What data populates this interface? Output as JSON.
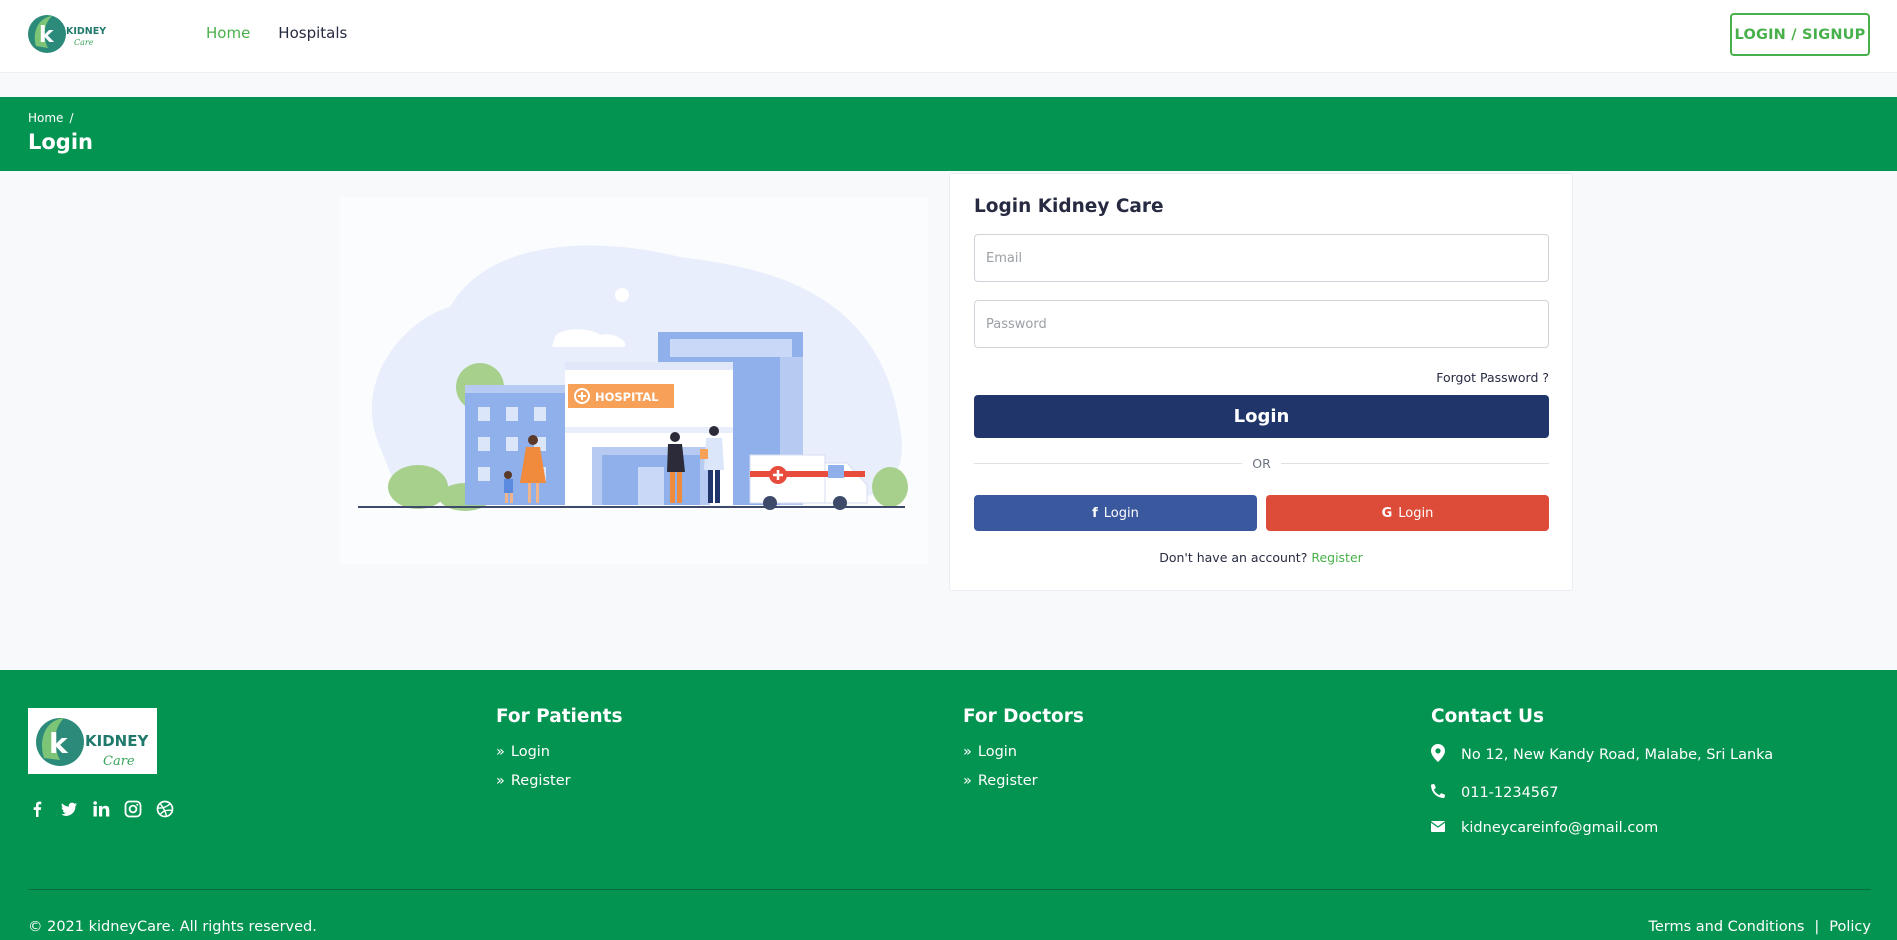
{
  "header": {
    "logo_alt": "KIDNEY Care",
    "nav": [
      {
        "label": "Home",
        "active": true
      },
      {
        "label": "Hospitals",
        "active": false
      }
    ],
    "login_signup": "LOGIN / SIGNUP"
  },
  "breadcrumb": {
    "items": [
      "Home",
      "/"
    ],
    "title": "Login"
  },
  "illustration": {
    "sign": "HOSPITAL"
  },
  "login_card": {
    "title": "Login Kidney Care",
    "email_placeholder": "Email",
    "password_placeholder": "Password",
    "forgot": "Forgot Password ?",
    "submit": "Login",
    "or": "OR",
    "facebook_login": "Login",
    "google_login": "Login",
    "no_account": "Don't have an account?",
    "register": "Register"
  },
  "footer": {
    "logo_alt": "KIDNEY Care",
    "patients": {
      "title": "For Patients",
      "links": [
        "Login",
        "Register"
      ]
    },
    "doctors": {
      "title": "For Doctors",
      "links": [
        "Login",
        "Register"
      ]
    },
    "contact": {
      "title": "Contact Us",
      "address": "No 12, New Kandy Road, Malabe, Sri Lanka",
      "phone": "011-1234567",
      "email": "kidneycareinfo@gmail.com"
    },
    "copyright": "© 2021 kidneyCare. All rights reserved.",
    "terms": "Terms and Conditions",
    "separator": "|",
    "policy": "Policy"
  },
  "colors": {
    "brand_green": "#049451",
    "accent_green": "#48b04a",
    "navy": "#20366b",
    "facebook": "#3a589e",
    "google": "#dd4b39"
  }
}
